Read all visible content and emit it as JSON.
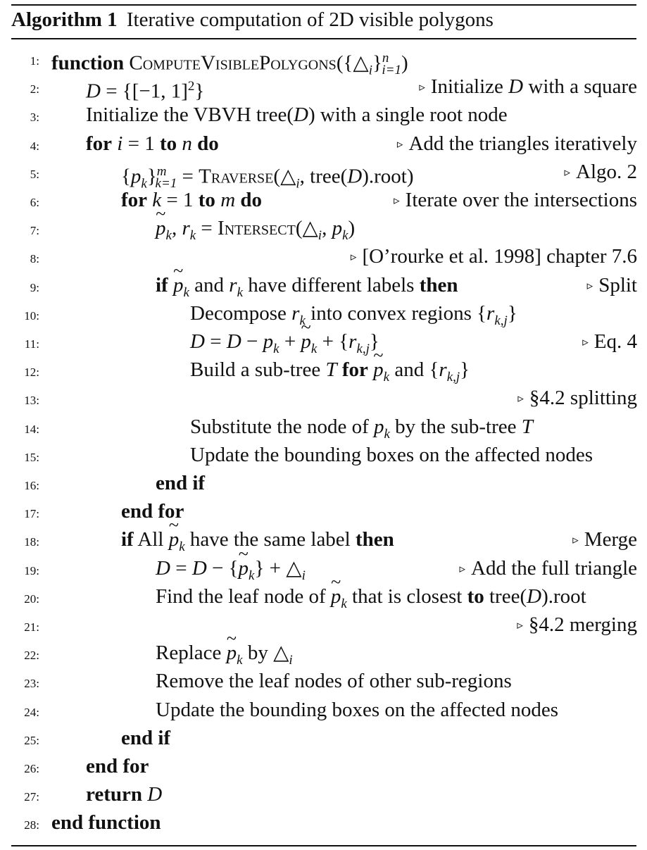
{
  "caption": {
    "label": "Algorithm 1",
    "title": "Iterative computation of 2D visible polygons"
  },
  "lines": [
    {
      "num": "1:",
      "indent": 0,
      "text": "function ComputeVisiblePolygons({△i}n i=1)",
      "comment": ""
    },
    {
      "num": "2:",
      "indent": 1,
      "text": "D = {[−1, 1]2}",
      "comment": "Initialize D with a square"
    },
    {
      "num": "3:",
      "indent": 1,
      "text": "Initialize the VBVH tree(D) with a single root node",
      "comment": ""
    },
    {
      "num": "4:",
      "indent": 1,
      "text": "for i = 1 to n do",
      "comment": "Add the triangles iteratively"
    },
    {
      "num": "5:",
      "indent": 2,
      "text": "{pk}m k=1 = Traverse(△i, tree(D).root)",
      "comment": "Algo. 2"
    },
    {
      "num": "6:",
      "indent": 2,
      "text": "for k = 1 to m do",
      "comment": "Iterate over the intersections"
    },
    {
      "num": "7:",
      "indent": 3,
      "text": "p̃k, rk = Intersect(△i, pk)",
      "comment": ""
    },
    {
      "num": "8:",
      "indent": 3,
      "text": "",
      "comment": "[O’rourke et al. 1998] chapter 7.6"
    },
    {
      "num": "9:",
      "indent": 3,
      "text": "if p̃k and rk have different labels then",
      "comment": "Split"
    },
    {
      "num": "10:",
      "indent": 4,
      "text": "Decompose rk into convex regions {rk,j}",
      "comment": ""
    },
    {
      "num": "11:",
      "indent": 4,
      "text": "D = D − pk + p̃k + {rk,j}",
      "comment": "Eq. 4"
    },
    {
      "num": "12:",
      "indent": 4,
      "text": "Build a sub-tree T for p̃k and {rk,j}",
      "comment": ""
    },
    {
      "num": "13:",
      "indent": 4,
      "text": "",
      "comment": "§4.2 splitting"
    },
    {
      "num": "14:",
      "indent": 4,
      "text": "Substitute the node of pk by the sub-tree T",
      "comment": ""
    },
    {
      "num": "15:",
      "indent": 4,
      "text": "Update the bounding boxes on the affected nodes",
      "comment": ""
    },
    {
      "num": "16:",
      "indent": 3,
      "text": "end if",
      "comment": ""
    },
    {
      "num": "17:",
      "indent": 2,
      "text": "end for",
      "comment": ""
    },
    {
      "num": "18:",
      "indent": 2,
      "text": "if All p̃k have the same label then",
      "comment": "Merge"
    },
    {
      "num": "19:",
      "indent": 3,
      "text": "D = D − {p̃k} + △i",
      "comment": "Add the full triangle"
    },
    {
      "num": "20:",
      "indent": 3,
      "text": "Find the leaf node of p̃k that is closest to tree(D).root",
      "comment": ""
    },
    {
      "num": "21:",
      "indent": 3,
      "text": "",
      "comment": "§4.2 merging"
    },
    {
      "num": "22:",
      "indent": 3,
      "text": "Replace p̃k by △i",
      "comment": ""
    },
    {
      "num": "23:",
      "indent": 3,
      "text": "Remove the leaf nodes of other sub-regions",
      "comment": ""
    },
    {
      "num": "24:",
      "indent": 3,
      "text": "Update the bounding boxes on the affected nodes",
      "comment": ""
    },
    {
      "num": "25:",
      "indent": 2,
      "text": "end if",
      "comment": ""
    },
    {
      "num": "26:",
      "indent": 1,
      "text": "end for",
      "comment": ""
    },
    {
      "num": "27:",
      "indent": 1,
      "text": "return D",
      "comment": ""
    },
    {
      "num": "28:",
      "indent": 0,
      "text": "end function",
      "comment": ""
    }
  ]
}
